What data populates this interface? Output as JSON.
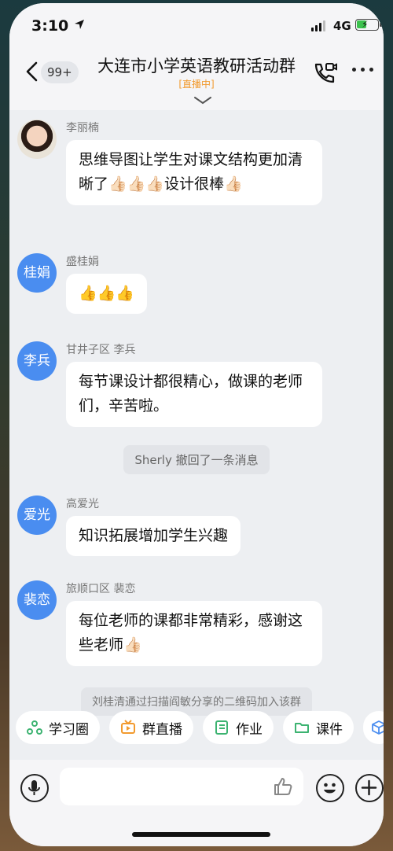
{
  "status_bar": {
    "time": "3:10",
    "network": "4G"
  },
  "header": {
    "unread_count": "99+",
    "title": "大连市小学英语教研活动群",
    "live_tag": "[直播中]"
  },
  "messages": [
    {
      "sender": "李丽楠",
      "avatar_text": "",
      "text": "思维导图让学生对课文结构更加清晰了👍🏻👍🏻👍🏻设计很棒👍🏻"
    },
    {
      "sender": "盛桂娟",
      "avatar_text": "桂娟",
      "text": "👍👍👍"
    },
    {
      "sender": "甘井子区 李兵",
      "avatar_text": "李兵",
      "text": "每节课设计都很精心，做课的老师们，辛苦啦。"
    },
    {
      "sender": "高爱光",
      "avatar_text": "爱光",
      "text": "知识拓展增加学生兴趣"
    },
    {
      "sender": "旅顺口区 裴恋",
      "avatar_text": "裴恋",
      "text": "每位老师的课都非常精彩，感谢这些老师👍🏻"
    }
  ],
  "system_messages": {
    "recall": "Sherly 撤回了一条消息",
    "join": "刘桂清通过扫描阎敏分享的二维码加入该群"
  },
  "toolbar": [
    {
      "label": "学习圈",
      "icon": "circle-network-icon",
      "color": "#3cb371"
    },
    {
      "label": "群直播",
      "icon": "live-tv-icon",
      "color": "#f29a2e"
    },
    {
      "label": "作业",
      "icon": "notebook-icon",
      "color": "#3cb371"
    },
    {
      "label": "课件",
      "icon": "folder-icon",
      "color": "#3cb371"
    }
  ],
  "colors": {
    "accent": "#4a8df0",
    "live": "#f29a2e",
    "bubble": "#ffffff",
    "chat_bg": "#edeff2"
  }
}
